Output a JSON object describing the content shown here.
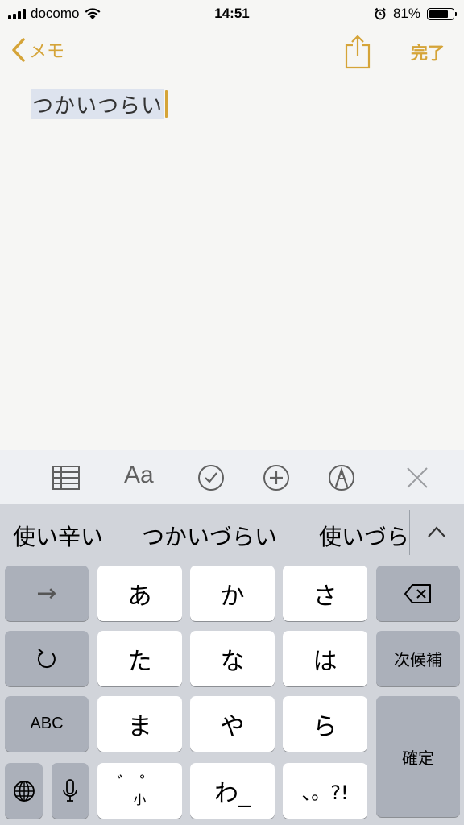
{
  "status_bar": {
    "carrier": "docomo",
    "time": "14:51",
    "battery_percent": "81%",
    "battery_level": 0.81,
    "icons": [
      "signal-icon",
      "wifi-icon",
      "alarm-icon",
      "battery-icon"
    ]
  },
  "nav": {
    "back_label": "メモ",
    "done_label": "完了",
    "accent_color": "#d5a438"
  },
  "note": {
    "text": "つかいつらい"
  },
  "toolbar": {
    "items": [
      "table-icon",
      "text-format-icon",
      "checklist-icon",
      "add-icon",
      "markup-icon",
      "close-icon"
    ],
    "format_label": "Aa"
  },
  "candidates": {
    "items": [
      "使い辛い",
      "つかいづらい",
      "使いづら"
    ]
  },
  "keyboard": {
    "keys": {
      "arrow": "→",
      "a": "あ",
      "ka": "か",
      "sa": "さ",
      "ta": "た",
      "na": "な",
      "ha": "は",
      "next_candidate": "次候補",
      "abc": "ABC",
      "ma": "ま",
      "ya": "や",
      "ra": "ら",
      "confirm": "確定",
      "dakuten": "゛゜",
      "dakuten_sub": "小",
      "wa": "わ_",
      "punct": "、。?!"
    }
  }
}
